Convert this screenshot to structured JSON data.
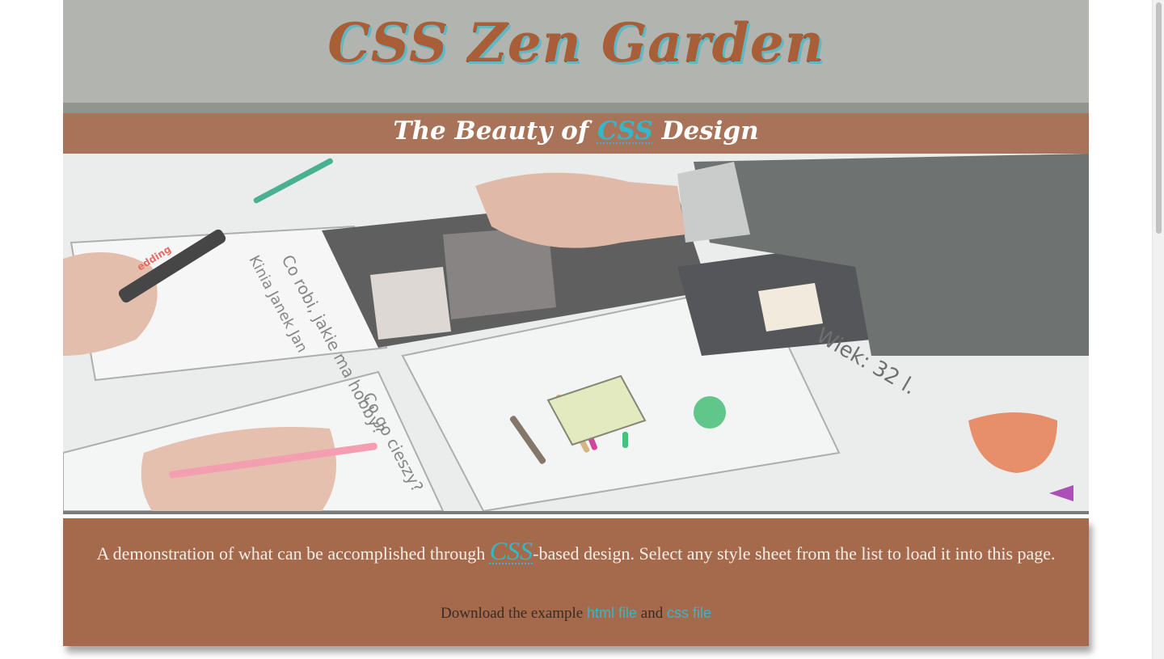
{
  "header": {
    "title": "CSS Zen Garden",
    "subtitle_before": "The Beauty of",
    "subtitle_abbr": "CSS",
    "subtitle_after": "Design"
  },
  "hero": {
    "note_top": "Co robi, jakie ma hobby?",
    "note_names": "Kinia Janek Jan",
    "note_bottom": "Co go cieszy?",
    "note_age": "Wiek: 32 l.",
    "marker_brand": "edding"
  },
  "intro": {
    "text_before": "A demonstration of what can be accomplished through",
    "abbr": "CSS",
    "text_after": "-based design. Select any style sheet from the list to load it into this page.",
    "download_prefix": "Download the example",
    "html_link": "html file",
    "download_and": "and",
    "css_link": "css file"
  },
  "colors": {
    "title": "#a85f37",
    "accent": "#37b6c9",
    "panel": "#a56a4c",
    "subtitle_band": "#a9735a"
  },
  "scrollbar": {
    "position": 0
  }
}
